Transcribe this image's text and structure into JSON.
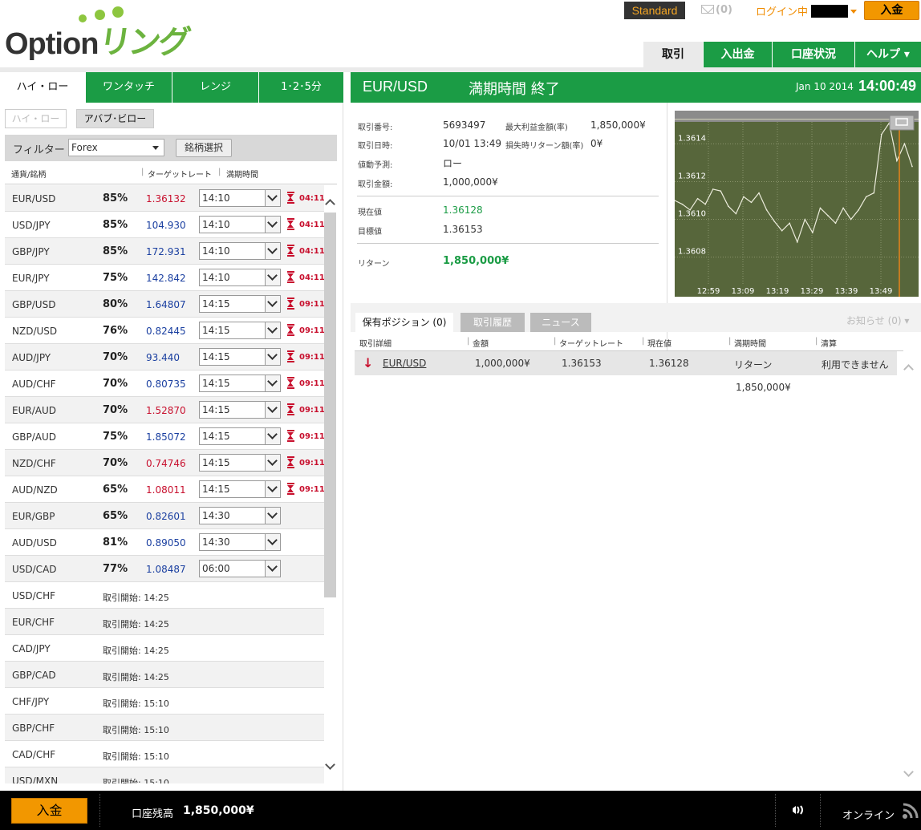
{
  "header": {
    "logo_text": "Option",
    "logo_katakana": "リング",
    "account_type": "Standard",
    "mail_count": "(0)",
    "login_status": "ログイン中",
    "deposit_label": "入金",
    "nav": [
      "取引",
      "入出金",
      "口座状況",
      "ヘルプ"
    ]
  },
  "trade_types": [
    "ハイ・ロー",
    "ワンタッチ",
    "レンジ",
    "1･2･5分"
  ],
  "subtabs": [
    "ハイ・ロー",
    "アバブ･ビロー"
  ],
  "filter": {
    "label": "フィルター",
    "selected": "Forex",
    "select_button": "銘柄選択"
  },
  "list_columns": [
    "通貨/銘柄",
    "ターゲットレート",
    "満期時間"
  ],
  "assets": [
    {
      "pair": "EUR/USD",
      "payout": "85%",
      "rate": "1.36132",
      "dir": "down",
      "expiry": "14:10",
      "countdown": "04:11"
    },
    {
      "pair": "USD/JPY",
      "payout": "85%",
      "rate": "104.930",
      "dir": "up",
      "expiry": "14:10",
      "countdown": "04:11"
    },
    {
      "pair": "GBP/JPY",
      "payout": "85%",
      "rate": "172.931",
      "dir": "up",
      "expiry": "14:10",
      "countdown": "04:11"
    },
    {
      "pair": "EUR/JPY",
      "payout": "75%",
      "rate": "142.842",
      "dir": "up",
      "expiry": "14:10",
      "countdown": "04:11"
    },
    {
      "pair": "GBP/USD",
      "payout": "80%",
      "rate": "1.64807",
      "dir": "up",
      "expiry": "14:15",
      "countdown": "09:11"
    },
    {
      "pair": "NZD/USD",
      "payout": "76%",
      "rate": "0.82445",
      "dir": "up",
      "expiry": "14:15",
      "countdown": "09:11"
    },
    {
      "pair": "AUD/JPY",
      "payout": "70%",
      "rate": "93.440",
      "dir": "up",
      "expiry": "14:15",
      "countdown": "09:11"
    },
    {
      "pair": "AUD/CHF",
      "payout": "70%",
      "rate": "0.80735",
      "dir": "up",
      "expiry": "14:15",
      "countdown": "09:11"
    },
    {
      "pair": "EUR/AUD",
      "payout": "70%",
      "rate": "1.52870",
      "dir": "down",
      "expiry": "14:15",
      "countdown": "09:11"
    },
    {
      "pair": "GBP/AUD",
      "payout": "75%",
      "rate": "1.85072",
      "dir": "up",
      "expiry": "14:15",
      "countdown": "09:11"
    },
    {
      "pair": "NZD/CHF",
      "payout": "70%",
      "rate": "0.74746",
      "dir": "down",
      "expiry": "14:15",
      "countdown": "09:11"
    },
    {
      "pair": "AUD/NZD",
      "payout": "65%",
      "rate": "1.08011",
      "dir": "down",
      "expiry": "14:15",
      "countdown": "09:11"
    },
    {
      "pair": "EUR/GBP",
      "payout": "65%",
      "rate": "0.82601",
      "dir": "up",
      "expiry": "14:30",
      "countdown": ""
    },
    {
      "pair": "AUD/USD",
      "payout": "81%",
      "rate": "0.89050",
      "dir": "up",
      "expiry": "14:30",
      "countdown": ""
    },
    {
      "pair": "USD/CAD",
      "payout": "77%",
      "rate": "1.08487",
      "dir": "up",
      "expiry": "06:00",
      "countdown": ""
    },
    {
      "pair": "USD/CHF",
      "opening": "取引開始: 14:25"
    },
    {
      "pair": "EUR/CHF",
      "opening": "取引開始: 14:25"
    },
    {
      "pair": "CAD/JPY",
      "opening": "取引開始: 14:25"
    },
    {
      "pair": "GBP/CAD",
      "opening": "取引開始: 14:25"
    },
    {
      "pair": "CHF/JPY",
      "opening": "取引開始: 15:10"
    },
    {
      "pair": "GBP/CHF",
      "opening": "取引開始: 15:10"
    },
    {
      "pair": "CAD/CHF",
      "opening": "取引開始: 15:10"
    },
    {
      "pair": "USD/MXN",
      "opening": "取引開始: 15:10"
    }
  ],
  "trade": {
    "pair": "EUR/USD",
    "status": "満期時間 終了",
    "date": "Jan 10 2014",
    "time": "14:00:49",
    "details": {
      "trade_no_label": "取引番号:",
      "trade_no": "5693497",
      "max_profit_label": "最大利益金額(率)",
      "max_profit": "1,850,000¥",
      "trade_date_label": "取引日時:",
      "trade_date": "10/01 13:49",
      "loss_return_label": "損失時リターン額(率)",
      "loss_return": "0¥",
      "prediction_label": "値動予測:",
      "prediction": "ロー",
      "amount_label": "取引金額:",
      "amount": "1,000,000¥",
      "current_label": "現在値",
      "current": "1.36128",
      "target_label": "目標値",
      "target": "1.36153",
      "return_label": "リターン",
      "return": "1,850,000¥"
    }
  },
  "chart_data": {
    "type": "line",
    "x_ticks": [
      "12:59",
      "13:09",
      "13:19",
      "13:29",
      "13:39",
      "13:49"
    ],
    "y_ticks": [
      "1.3614",
      "1.3612",
      "1.3610",
      "1.3608"
    ],
    "ylim": [
      1.36065,
      1.36155
    ],
    "x": [
      0,
      2,
      4,
      6,
      8,
      10,
      12,
      14,
      16,
      18,
      20,
      22,
      24,
      26,
      28,
      30,
      32,
      34,
      36,
      38,
      40,
      42,
      44,
      46,
      48,
      50,
      52,
      54,
      56,
      58,
      60,
      62
    ],
    "values": [
      1.3611,
      1.36108,
      1.36105,
      1.36111,
      1.36108,
      1.36116,
      1.36115,
      1.36107,
      1.36103,
      1.36112,
      1.36109,
      1.36114,
      1.36105,
      1.36099,
      1.36094,
      1.36098,
      1.36088,
      1.361,
      1.36093,
      1.36106,
      1.36102,
      1.36098,
      1.36106,
      1.361,
      1.36105,
      1.36112,
      1.36114,
      1.36145,
      1.36151,
      1.36131,
      1.3614,
      1.36128
    ],
    "target": 1.36153,
    "grid": true,
    "colors": {
      "background": "#57663b",
      "line": "#ececdc",
      "marker": "#e8831b"
    }
  },
  "positions": {
    "tabs": [
      "保有ポジション (0)",
      "取引履歴",
      "ニュース"
    ],
    "notice": "お知らせ (0)",
    "columns": [
      "取引詳細",
      "金額",
      "ターゲットレート",
      "現在値",
      "満期時間",
      "清算"
    ],
    "row": {
      "pair": "EUR/USD",
      "amount": "1,000,000¥",
      "target": "1.36153",
      "current": "1.36128",
      "expiry": "リターン",
      "settle": "利用できません",
      "return": "1,850,000¥"
    }
  },
  "footer": {
    "deposit_label": "入金",
    "balance_label": "口座残高",
    "balance": "1,850,000¥",
    "online_label": "オンライン"
  }
}
